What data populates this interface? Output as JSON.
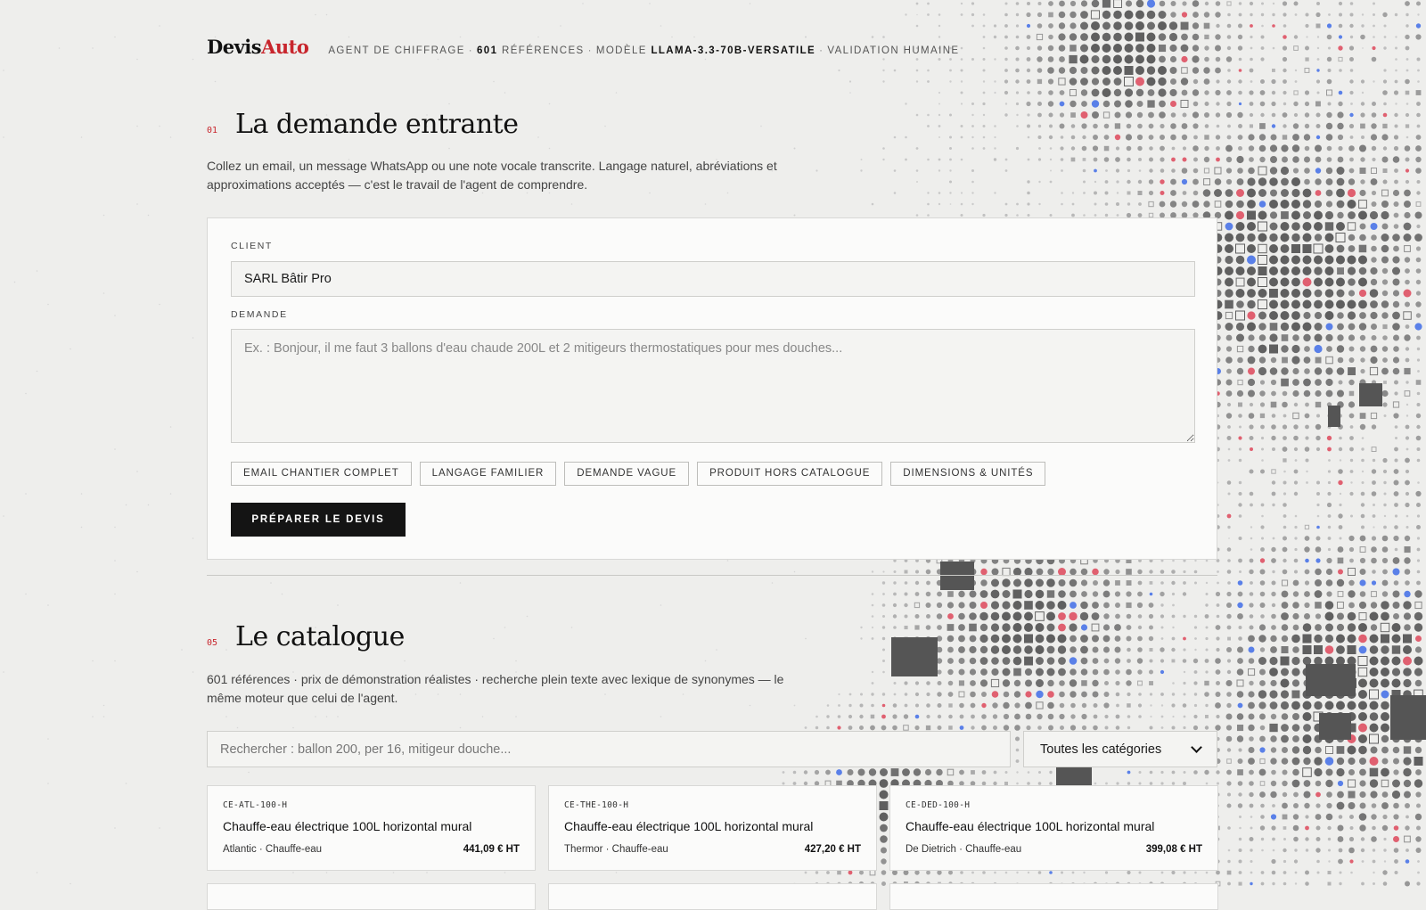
{
  "brand": {
    "part1": "Devis",
    "part2": "Auto"
  },
  "header": {
    "tagline_1": "AGENT DE CHIFFRAGE",
    "sep": "·",
    "refs_count": "601",
    "refs_label": "RÉFÉRENCES",
    "model_label": "MODÈLE",
    "model_name": "LLAMA-3.3-70B-VERSATILE",
    "validation": "VALIDATION HUMAINE"
  },
  "request_section": {
    "number": "01",
    "title": "La demande entrante",
    "description": "Collez un email, un message WhatsApp ou une note vocale transcrite. Langage naturel, abréviations et approximations acceptés — c'est le travail de l'agent de comprendre.",
    "client_label": "CLIENT",
    "client_value": "SARL Bâtir Pro",
    "request_label": "DEMANDE",
    "request_placeholder": "Ex. : Bonjour, il me faut 3 ballons d'eau chaude 200L et 2 mitigeurs thermostatiques pour mes douches...",
    "examples": [
      "EMAIL CHANTIER COMPLET",
      "LANGAGE FAMILIER",
      "DEMANDE VAGUE",
      "PRODUIT HORS CATALOGUE",
      "DIMENSIONS & UNITÉS"
    ],
    "submit_label": "PRÉPARER LE DEVIS"
  },
  "catalog_section": {
    "number": "05",
    "title": "Le catalogue",
    "description": "601 références · prix de démonstration réalistes · recherche plein texte avec lexique de synonymes — le même moteur que celui de l'agent.",
    "search_placeholder": "Rechercher : ballon 200, per 16, mitigeur douche...",
    "category_selected": "Toutes les catégories",
    "products": [
      {
        "ref": "CE-ATL-100-H",
        "name": "Chauffe-eau électrique 100L horizontal mural",
        "meta": "Atlantic · Chauffe-eau",
        "price": "441,09 € HT"
      },
      {
        "ref": "CE-THE-100-H",
        "name": "Chauffe-eau électrique 100L horizontal mural",
        "meta": "Thermor · Chauffe-eau",
        "price": "427,20 € HT"
      },
      {
        "ref": "CE-DED-100-H",
        "name": "Chauffe-eau électrique 100L horizontal mural",
        "meta": "De Dietrich · Chauffe-eau",
        "price": "399,08 € HT"
      }
    ]
  },
  "colors": {
    "accent": "#c8252c",
    "ink": "#141414",
    "background": "#eeeeec",
    "dot_blue": "#4a72e8"
  }
}
